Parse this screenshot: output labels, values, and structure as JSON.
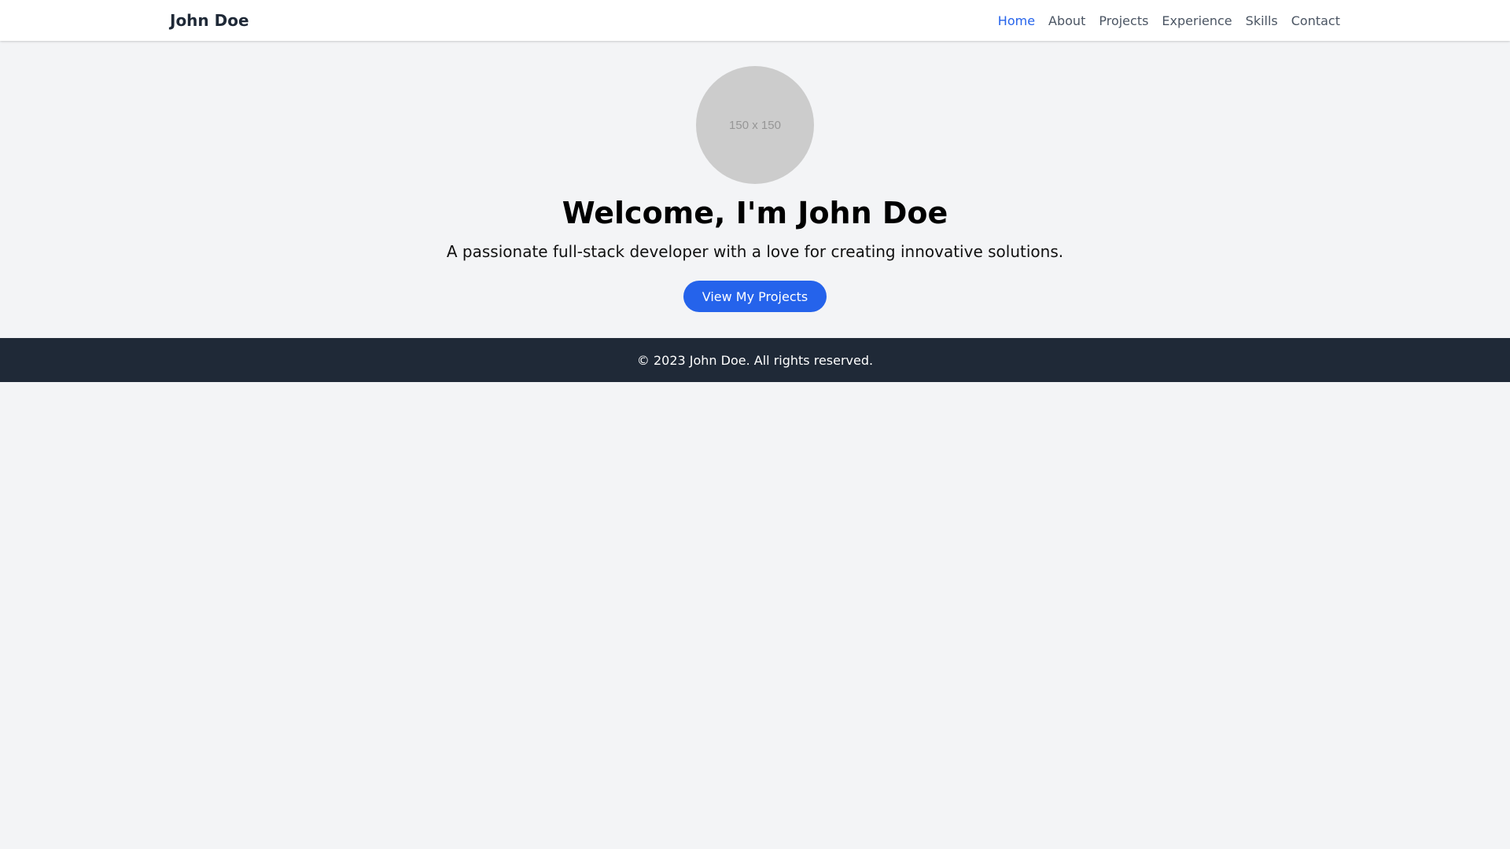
{
  "navbar": {
    "brand": "John Doe",
    "links": [
      {
        "label": "Home",
        "active": true
      },
      {
        "label": "About"
      },
      {
        "label": "Projects"
      },
      {
        "label": "Experience"
      },
      {
        "label": "Skills"
      },
      {
        "label": "Contact"
      }
    ]
  },
  "hero": {
    "avatar_placeholder": "150 x 150",
    "title": "Welcome, I'm John Doe",
    "subtitle": "A passionate full-stack developer with a love for creating innovative solutions.",
    "cta_label": "View My Projects"
  },
  "footer": {
    "copyright": "© 2023 John Doe. All rights reserved."
  },
  "colors": {
    "accent": "#2563eb",
    "page_background": "#f3f4f6",
    "footer_background": "#1f2937",
    "nav_text": "#4b5563"
  }
}
